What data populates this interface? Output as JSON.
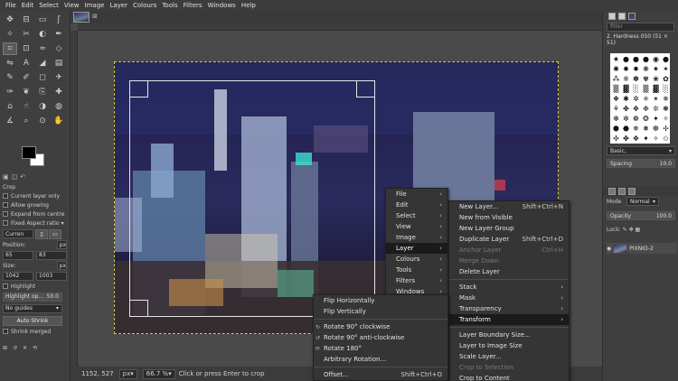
{
  "menubar": [
    "File",
    "Edit",
    "Select",
    "View",
    "Image",
    "Layer",
    "Colours",
    "Tools",
    "Filters",
    "Windows",
    "Help"
  ],
  "tool_icons": [
    "move-icon",
    "align-icon",
    "rect-select-icon",
    "free-select-icon",
    "fuzzy-select-icon",
    "scissors-icon",
    "foreground-select-icon",
    "paths-icon",
    "crop-icon",
    "unified-transform-icon",
    "warp-icon",
    "cage-icon",
    "flip-icon",
    "text-icon",
    "bucket-fill-icon",
    "gradient-icon",
    "pencil-icon",
    "paintbrush-icon",
    "eraser-icon",
    "airbrush-icon",
    "ink-icon",
    "mypaint-icon",
    "clone-icon",
    "heal-icon",
    "perspective-clone-icon",
    "smudge-icon",
    "dodge-burn-icon",
    "blur-icon",
    "measure-icon",
    "zoom-icon",
    "color-picker-icon",
    "handle-icon"
  ],
  "tool_options": {
    "title": "Crop",
    "current_layer_only": "Current layer only",
    "allow_growing": "Allow growing",
    "expand_from_centre": "Expand from centre",
    "fixed_aspect_ratio": "Fixed Aspect ratio",
    "current_value": "Curren",
    "position_label": "Position:",
    "position_unit": "px",
    "position_x": "65",
    "position_y": "83",
    "size_label": "Size:",
    "size_unit": "px",
    "size_w": "1042",
    "size_h": "1003",
    "highlight": "Highlight",
    "highlight_opacity_label": "Highlight op...",
    "highlight_opacity_value": "50.0",
    "guides": "No guides",
    "auto_shrink": "Auto Shrink",
    "shrink_merged": "Shrink merged"
  },
  "status": {
    "coords": "1152, 527",
    "unit": "px",
    "zoom": "66.7 %",
    "message": "Click or press Enter to crop"
  },
  "right_dock": {
    "filter_placeholder": "filter",
    "brush_name": "2. Hardness 050 (51 × 51)",
    "preset": "Basic,",
    "spacing_label": "Spacing",
    "spacing_value": "10.0",
    "mode_label": "Mode",
    "mode_value": "Normal",
    "opacity_label": "Opacity",
    "opacity_value": "100.0",
    "lock_label": "Lock:",
    "layer_name": "PIXNIO-2"
  },
  "menu_image": {
    "items": [
      {
        "label": "File",
        "arrow": "›"
      },
      {
        "label": "Edit",
        "arrow": "›"
      },
      {
        "label": "Select",
        "arrow": "›"
      },
      {
        "label": "View",
        "arrow": "›"
      },
      {
        "label": "Image",
        "arrow": "›"
      },
      {
        "label": "Layer",
        "arrow": "›"
      },
      {
        "label": "Colours",
        "arrow": "›"
      },
      {
        "label": "Tools",
        "arrow": "›"
      },
      {
        "label": "Filters",
        "arrow": "›"
      },
      {
        "label": "Windows",
        "arrow": "›"
      }
    ]
  },
  "menu_layer": {
    "items": [
      {
        "label": "New Layer...",
        "shortcut": "Shift+Ctrl+N"
      },
      {
        "label": "New from Visible",
        "shortcut": ""
      },
      {
        "label": "New Layer Group",
        "shortcut": ""
      },
      {
        "label": "Duplicate Layer",
        "shortcut": "Shift+Ctrl+D"
      },
      {
        "label": "Anchor Layer",
        "shortcut": "Ctrl+H"
      },
      {
        "label": "Merge Down",
        "shortcut": ""
      },
      {
        "label": "Delete Layer",
        "shortcut": ""
      },
      {
        "label": "Stack",
        "shortcut": "›"
      },
      {
        "label": "Mask",
        "shortcut": "›"
      },
      {
        "label": "Transparency",
        "shortcut": "›"
      },
      {
        "label": "Transform",
        "shortcut": "›"
      },
      {
        "label": "Layer Boundary Size...",
        "shortcut": ""
      },
      {
        "label": "Layer to Image Size",
        "shortcut": ""
      },
      {
        "label": "Scale Layer...",
        "shortcut": ""
      },
      {
        "label": "Crop to Selection",
        "shortcut": ""
      },
      {
        "label": "Crop to Content",
        "shortcut": ""
      }
    ]
  },
  "menu_transform": {
    "items": [
      {
        "label": "Flip Horizontally",
        "shortcut": ""
      },
      {
        "label": "Flip Vertically",
        "shortcut": ""
      },
      {
        "label": "Rotate 90° clockwise",
        "shortcut": ""
      },
      {
        "label": "Rotate 90° anti-clockwise",
        "shortcut": ""
      },
      {
        "label": "Rotate 180°",
        "shortcut": ""
      },
      {
        "label": "Arbitrary Rotation...",
        "shortcut": ""
      },
      {
        "label": "Offset...",
        "shortcut": "Shift+Ctrl+O"
      }
    ]
  },
  "colors": {
    "menu_bg": "#353535",
    "highlight": "#1b1b1b",
    "selection_border": "#d8cc50"
  }
}
